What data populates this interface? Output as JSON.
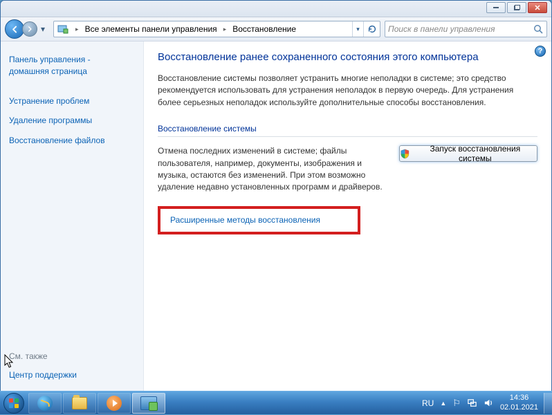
{
  "titlebar": {
    "min_tip": "Minimize",
    "max_tip": "Maximize",
    "close_tip": "Close"
  },
  "addr": {
    "crumb1": "Все элементы панели управления",
    "crumb2": "Восстановление",
    "search_placeholder": "Поиск в панели управления"
  },
  "sidebar": {
    "home1": "Панель управления -",
    "home2": "домашняя страница",
    "troubleshoot": "Устранение проблем",
    "uninstall": "Удаление программы",
    "file_recovery": "Восстановление файлов",
    "see_also": "См. также",
    "action_center": "Центр поддержки"
  },
  "main": {
    "title": "Восстановление ранее сохраненного состояния этого компьютера",
    "description": "Восстановление системы позволяет устранить многие неполадки в системе; это средство рекомендуется использовать для устранения неполадок в первую очередь. Для устранения более серьезных неполадок используйте дополнительные способы восстановления.",
    "section_head": "Восстановление системы",
    "section_text": "Отмена последних изменений в системе; файлы пользователя, например, документы, изображения и музыка, остаются без изменений. При этом возможно удаление недавно установленных программ и драйверов.",
    "restore_btn": "Запуск восстановления системы",
    "advanced_link": "Расширенные методы восстановления"
  },
  "taskbar": {
    "lang": "RU",
    "time": "14:36",
    "date": "02.01.2021"
  }
}
